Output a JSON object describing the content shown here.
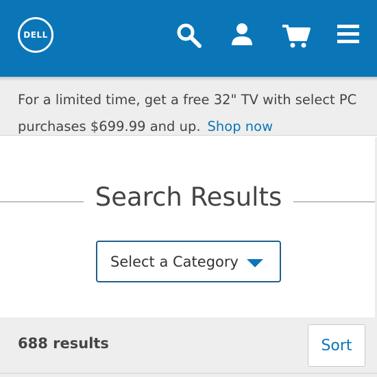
{
  "header": {
    "logo_text": "DELL",
    "icons": [
      "search-icon",
      "user-icon",
      "cart-icon",
      "menu-icon"
    ],
    "background": "#0a76b8"
  },
  "promo": {
    "text": "For a limited time, get a free 32\" TV with select PC purchases $699.99 and up.",
    "link": "Shop now"
  },
  "main": {
    "title": "Search Results",
    "category_select": "Select a Category"
  },
  "results": {
    "count": "688 results",
    "sort_label": "Sort"
  }
}
